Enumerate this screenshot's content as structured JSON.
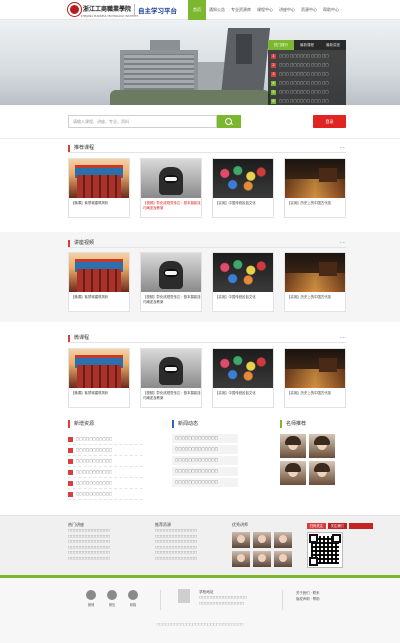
{
  "header": {
    "logo_text": "浙江工商職業學院",
    "logo_en": "ZHEJIANG BUSINESS TECHNOLOGY INSTITUTE",
    "platform": "自主学习平台",
    "nav": [
      "首页",
      "通知公告",
      "专业资源库",
      "课程中心",
      "讲座中心",
      "资源中心",
      "帮助中心"
    ],
    "nav_active": 0
  },
  "banner": {
    "rank_tabs": [
      "热门排行",
      "最新课程",
      "最新讲座"
    ],
    "rank_items": [
      {
        "no": "1",
        "text": "□□□ □□□□□□ □□□ □□"
      },
      {
        "no": "2",
        "text": "□□□ □□□□□□ □□□ □□"
      },
      {
        "no": "3",
        "text": "□□□ □□□□□□ □□□ □□"
      },
      {
        "no": "4",
        "text": "□□□ □□□□□□ □□□ □□"
      },
      {
        "no": "5",
        "text": "□□□ □□□□□□ □□□ □□"
      },
      {
        "no": "6",
        "text": "□□□ □□□□□□ □□□ □□"
      },
      {
        "no": "7",
        "text": "□□□ □□□□□□ □□□ □□"
      },
      {
        "no": "8",
        "text": "□□□ □□□□□□ □□□ □□"
      }
    ]
  },
  "search": {
    "placeholder": "请输入课程、讲座、专业、资料",
    "login_label": "登录"
  },
  "sections": [
    {
      "title": "推荐课程",
      "more": "••",
      "cards": [
        {
          "cap": "【微课】紫禁城建筑简析",
          "red": false
        },
        {
          "cap": "【视频】彰化线视觉传达：基本摄影技巧阐述及教案",
          "red": true
        },
        {
          "cap": "【实用】中国传统民俗文化",
          "red": false
        },
        {
          "cap": "【实用】历史上的中国古代技",
          "red": false
        }
      ]
    },
    {
      "title": "讲座视频",
      "more": "••",
      "cards": [
        {
          "cap": "【微课】紫禁城建筑简析",
          "red": false
        },
        {
          "cap": "【视频】彰化线视觉传达：基本摄影技巧阐述及教案",
          "red": false
        },
        {
          "cap": "【实用】中国传统民俗文化",
          "red": false
        },
        {
          "cap": "【实用】历史上的中国古代技",
          "red": false
        }
      ]
    },
    {
      "title": "微课程",
      "more": "••",
      "cards": [
        {
          "cap": "【微课】紫禁城建筑简析",
          "red": false
        },
        {
          "cap": "【视频】彰化线视觉传达：基本摄影技巧阐述及教案",
          "red": false
        },
        {
          "cap": "【实用】中国传统民俗文化",
          "red": false
        },
        {
          "cap": "【实用】历史上的中国古代技",
          "red": false
        }
      ]
    }
  ],
  "info": {
    "col1": {
      "title": "新增资源",
      "items": [
        "□□□□□□□□□□□",
        "□□□□□□□□□□□",
        "□□□□□□□□□□□",
        "□□□□□□□□□□□",
        "□□□□□□□□□□□",
        "□□□□□□□□□□□"
      ]
    },
    "col2": {
      "title": "新闻动态",
      "items": [
        "□□□□□□□□□□□□□",
        "□□□□□□□□□□□□□",
        "□□□□□□□□□□□□□",
        "□□□□□□□□□□□□□",
        "□□□□□□□□□□□□□"
      ]
    },
    "col3": {
      "title": "名师推荐"
    }
  },
  "footer": {
    "col1": {
      "title": "热门讲座",
      "lines": [
        "□□□□□□□□□□□□□□",
        "□□□□□□□□□□□□□□",
        "□□□□□□□□□□□□□□",
        "□□□□□□□□□□□□□□",
        "□□□□□□□□□□□□□□",
        "□□□□□□□□□□□□□□"
      ]
    },
    "col2": {
      "title": "推荐资源",
      "lines": [
        "□□□□□□□□□□□□□□",
        "□□□□□□□□□□□□□□",
        "□□□□□□□□□□□□□□",
        "□□□□□□□□□□□□□□",
        "□□□□□□□□□□□□□□",
        "□□□□□□□□□□□□□□"
      ]
    },
    "col3": {
      "title": "优秀讲师"
    },
    "qr_labels": [
      "扫码关注",
      "关注我们"
    ]
  },
  "bottom": {
    "icons": [
      "微博",
      "微信",
      "邮箱"
    ],
    "mid_title": "学校地址",
    "mid_lines": [
      "□□□□□□□□□□□□□□□□",
      "□□□□□□□□□□□□□□□"
    ],
    "links": [
      "关于我们 · 联系",
      "版权声明 · 帮助"
    ],
    "copyright": "□□□□□□□□□□□□□□□□□□□□□□□□□□□□□"
  },
  "colors": {
    "accent_green": "#7cb82f",
    "accent_red": "#d93f3f",
    "nav_text": "#555555"
  }
}
